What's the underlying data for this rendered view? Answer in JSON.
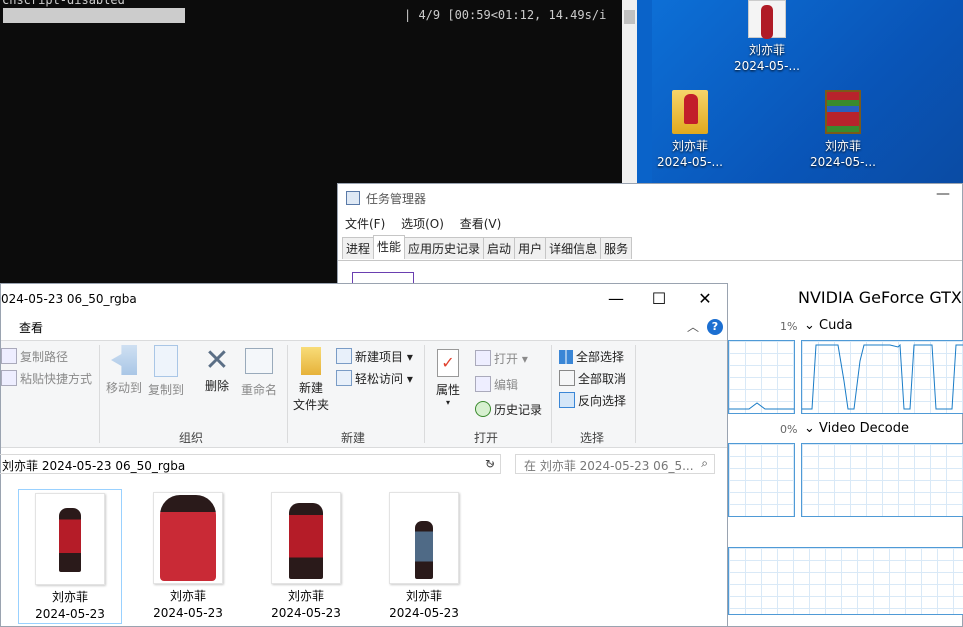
{
  "console": {
    "line1": "chscript-disabled",
    "progress": "| 4/9 [00:59<01:12, 14.49s/i"
  },
  "desktop": {
    "icons": [
      {
        "name": "刘亦菲",
        "date": "2024-05-..."
      },
      {
        "name": "刘亦菲",
        "date": "2024-05-..."
      },
      {
        "name": "刘亦菲",
        "date": "2024-05-..."
      }
    ]
  },
  "taskmgr": {
    "title": "任务管理器",
    "minimize": "—",
    "menu": [
      "文件(F)",
      "选项(O)",
      "查看(V)"
    ],
    "tabs": [
      "进程",
      "性能",
      "应用历史记录",
      "启动",
      "用户",
      "详细信息",
      "服务"
    ],
    "active_tab": "性能",
    "gpu_title": "NVIDIA GeForce GTX",
    "graphs": [
      {
        "pct": "1%",
        "label": "Cuda"
      },
      {
        "pct": "0%",
        "label": "Video Decode"
      }
    ]
  },
  "explorer": {
    "title": "024-05-23 06_50_rgba",
    "tab_view": "查看",
    "win_buttons": {
      "minimize": "—",
      "maximize": "☐",
      "close": "✕"
    },
    "help": "?",
    "ribbon": {
      "copy_path": "复制路径",
      "paste_shortcut": "粘贴快捷方式",
      "move_to": "移动到",
      "copy_to": "复制到",
      "delete": "删除",
      "rename": "重命名",
      "new_folder_1": "新建",
      "new_folder_2": "文件夹",
      "new_item": "新建项目",
      "easy_access": "轻松访问",
      "properties": "属性",
      "open": "打开",
      "edit": "编辑",
      "history": "历史记录",
      "select_all": "全部选择",
      "select_none": "全部取消",
      "invert_selection": "反向选择",
      "groups": {
        "organize": "组织",
        "new": "新建",
        "open": "打开",
        "select": "选择"
      }
    },
    "address": "刘亦菲 2024-05-23 06_50_rgba",
    "search_placeholder": "在 刘亦菲 2024-05-23 06_5...",
    "files": [
      {
        "name": "刘亦菲",
        "date": "2024-05-23"
      },
      {
        "name": "刘亦菲",
        "date": "2024-05-23"
      },
      {
        "name": "刘亦菲",
        "date": "2024-05-23"
      },
      {
        "name": "刘亦菲",
        "date": "2024-05-23"
      }
    ]
  }
}
